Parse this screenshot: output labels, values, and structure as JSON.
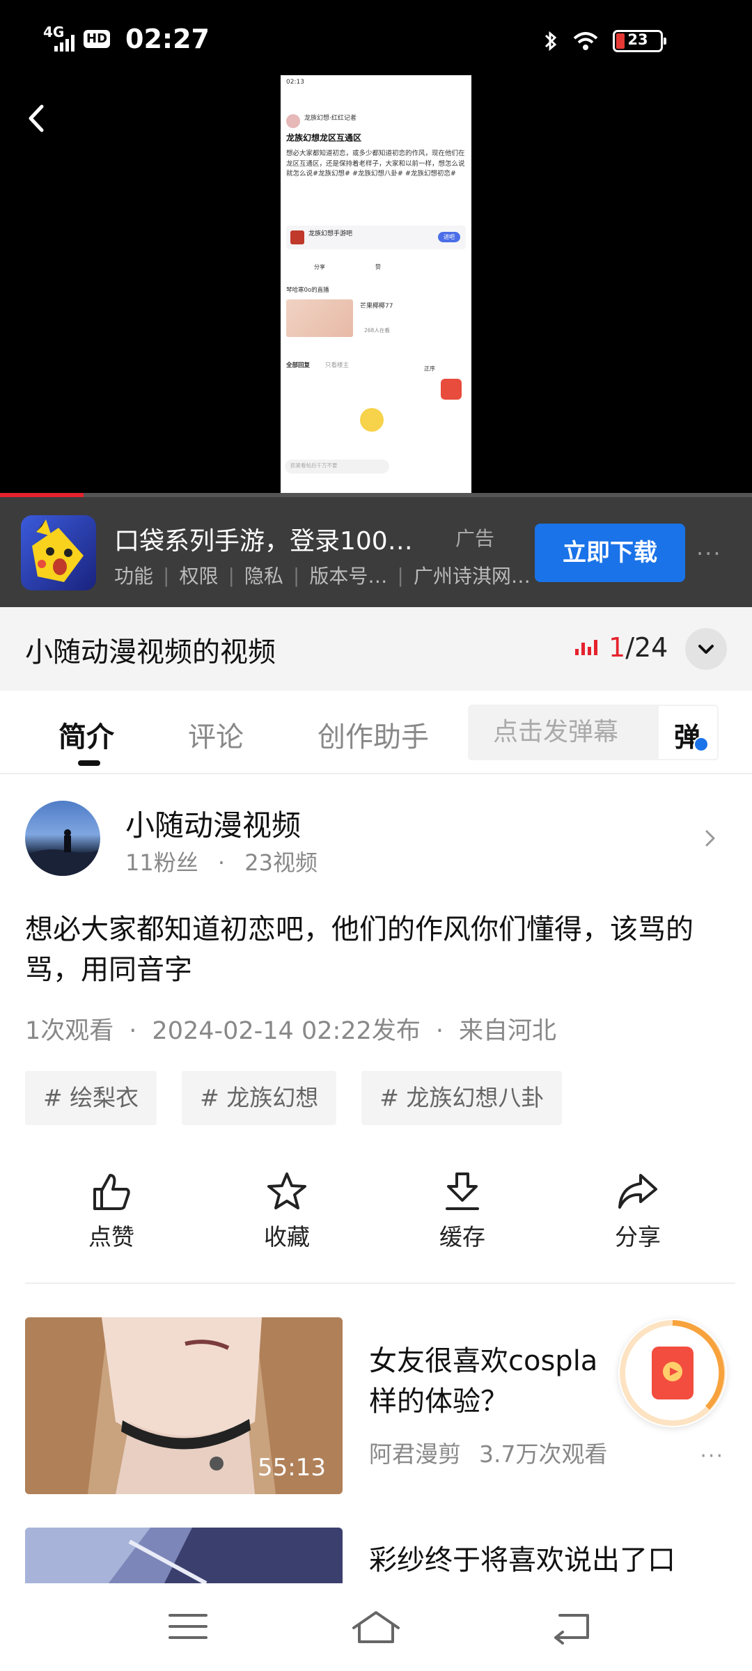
{
  "status_bar": {
    "network": "4G",
    "hd_badge": "HD",
    "time": "02:27",
    "battery": "23"
  },
  "ad": {
    "title": "口袋系列手游，登录100…",
    "tag": "广告",
    "links": [
      "功能",
      "权限",
      "隐私"
    ],
    "version": "版本号…",
    "developer": "广州诗淇网…",
    "download_label": "立即下载",
    "more": "···"
  },
  "playlist": {
    "title": "小随动漫视频的视频",
    "current": "1",
    "total": "/24"
  },
  "tabs": {
    "intro": "简介",
    "comments": "评论",
    "creator": "创作助手"
  },
  "danmaku": {
    "placeholder": "点击发弹幕",
    "toggle": "弹"
  },
  "author": {
    "name": "小随动漫视频",
    "fans": "11粉丝",
    "separator": "·",
    "videos": "23视频"
  },
  "video": {
    "description": "想必大家都知道初恋吧，他们的作风你们懂得，该骂的骂，用同音字",
    "views": "1次观看",
    "published": "2024-02-14 02:22发布",
    "location": "来自河北",
    "tags": [
      "# 绘梨衣",
      "# 龙族幻想",
      "# 龙族幻想八卦"
    ]
  },
  "actions": {
    "like": "点赞",
    "favorite": "收藏",
    "cache": "缓存",
    "share": "分享"
  },
  "recommendations": [
    {
      "title": "女友很喜欢cosplay…样的体验？",
      "title_line1": "女友很喜欢cospla",
      "title_line2": "样的体验？",
      "duration": "55:13",
      "uploader": "阿君漫剪",
      "views": "3.7万次观看",
      "more": "···"
    },
    {
      "title": "彩纱终于将喜欢说出了口"
    }
  ],
  "embedded_post": {
    "status_time": "02:13",
    "author": "龙族幻想·红红记者",
    "title": "龙族幻想龙区互通区",
    "body": "想必大家都知道初恋，或多少都知道初恋的作风，现在他们在龙区互通区，还是保持着老样子，大家和以前一样，想怎么说就怎么说#龙族幻想# #龙族幻想八卦# #龙族幻想初恋#",
    "forum": "龙族幻想手游吧",
    "forum_btn": "进吧",
    "share": "分享",
    "like": "赞",
    "live_section": "琴哈寒0o的直播",
    "live_name": "芒果椰椰77",
    "live_viewers": "268人在看",
    "all_replies": "全部回复",
    "only_op": "只看楼主",
    "sort": "正序",
    "reply_placeholder": "抓紧看帖后千万不要"
  },
  "colors": {
    "accent_red": "#e5232e",
    "download_blue": "#1a73e8",
    "ad_bg": "#3c3c3c"
  }
}
